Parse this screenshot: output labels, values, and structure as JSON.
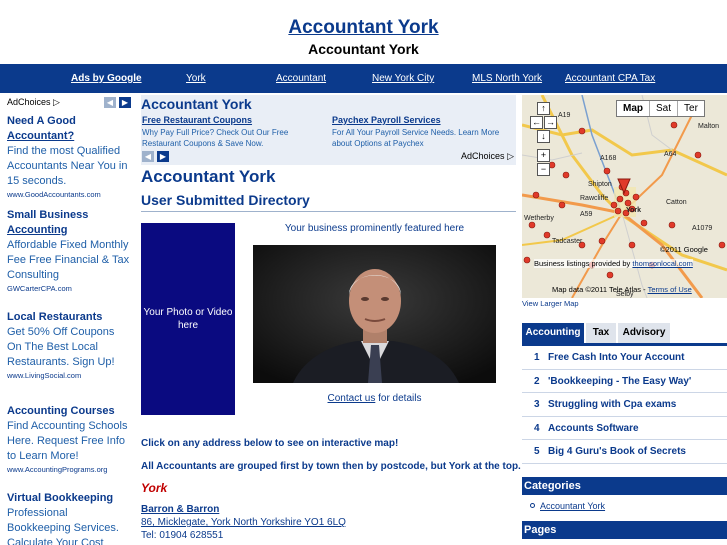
{
  "header": {
    "title": "Accountant York",
    "subtitle": "Accountant York"
  },
  "nav": {
    "ads_label": "Ads by Google",
    "links": [
      "York",
      "Accountant",
      "New York City",
      "MLS North York",
      "Accountant CPA Tax"
    ]
  },
  "left_ads": {
    "adchoices": "AdChoices",
    "items": [
      {
        "title_line1": "Need A Good",
        "title_line2": "Accountant?",
        "body": "Find the most Qualified Accountants Near You in 15 seconds.",
        "url": "www.GoodAccountants.com"
      },
      {
        "title_line1": "Small Business",
        "title_line2": "Accounting",
        "body": "Affordable Fixed Monthly Fee Free Financial & Tax Consulting",
        "url": "GWCarterCPA.com"
      },
      {
        "title_line1": "Local Restaurants",
        "title_line2": "",
        "body": "Get 50% Off Coupons On The Best Local Restaurants. Sign Up!",
        "url": "www.LivingSocial.com"
      },
      {
        "title_line1": "Accounting Courses",
        "title_line2": "",
        "body": "Find Accounting Schools Here. Request Free Info to Learn More!",
        "url": "www.AccountingPrograms.org"
      },
      {
        "title_line1": "Virtual Bookkeeping",
        "title_line2": "",
        "body": "Professional Bookkeeping Services. Calculate Your Cost",
        "url": ""
      }
    ]
  },
  "top_ads": {
    "heading": "Accountant York",
    "adchoices": "AdChoices",
    "items": [
      {
        "title": "Free Restaurant Coupons",
        "body": "Why Pay Full Price? Check Out Our Free Restaurant Coupons & Save Now."
      },
      {
        "title": "Paychex Payroll Services",
        "body": "For All Your Payroll Service Needs. Learn More about Options at Paychex"
      }
    ]
  },
  "main": {
    "heading": "Accountant York",
    "subheading": "User Submitted Directory",
    "photo_placeholder": "Your Photo or Video here",
    "featured_text": "Your business prominently featured here",
    "contact_link": "Contact us",
    "contact_suffix": " for details",
    "map_instruction": "Click on any address below to see on interactive map!",
    "group_note": "All Accountants are grouped first by town then by postcode, but York at the top.",
    "town": "York",
    "listing": {
      "name": "Barron & Barron",
      "address": "86, Micklegate, York North Yorkshire YO1 6LQ",
      "tel": "Tel: 01904 628551"
    }
  },
  "map": {
    "types": [
      "Map",
      "Sat",
      "Ter"
    ],
    "places": [
      "Malton",
      "Shipton",
      "Rawcliffe",
      "York",
      "Catton",
      "Tadcaster",
      "Wetherby",
      "Selby"
    ],
    "roads": [
      "A19",
      "A64",
      "A59",
      "A1079",
      "A168"
    ],
    "copyright": "©2011 Google",
    "business_text": "Business listings provided by ",
    "business_link": "thomsonlocal.com",
    "map_data": "Map data ©2011 Tele Atlas",
    "terms": "Terms of Use",
    "larger_link": "View Larger Map"
  },
  "tabs": {
    "labels": [
      "Accounting",
      "Tax",
      "Advisory"
    ],
    "active": "Accounting",
    "items": [
      {
        "num": "1",
        "label": "Free Cash Into Your Account"
      },
      {
        "num": "2",
        "label": "'Bookkeeping - The Easy Way'"
      },
      {
        "num": "3",
        "label": "Struggling with Cpa exams"
      },
      {
        "num": "4",
        "label": "Accounts Software"
      },
      {
        "num": "5",
        "label": "Big 4 Guru's Book of Secrets"
      }
    ]
  },
  "sidebar": {
    "categories_heading": "Categories",
    "categories": [
      "Accountant York"
    ],
    "pages_heading": "Pages"
  }
}
